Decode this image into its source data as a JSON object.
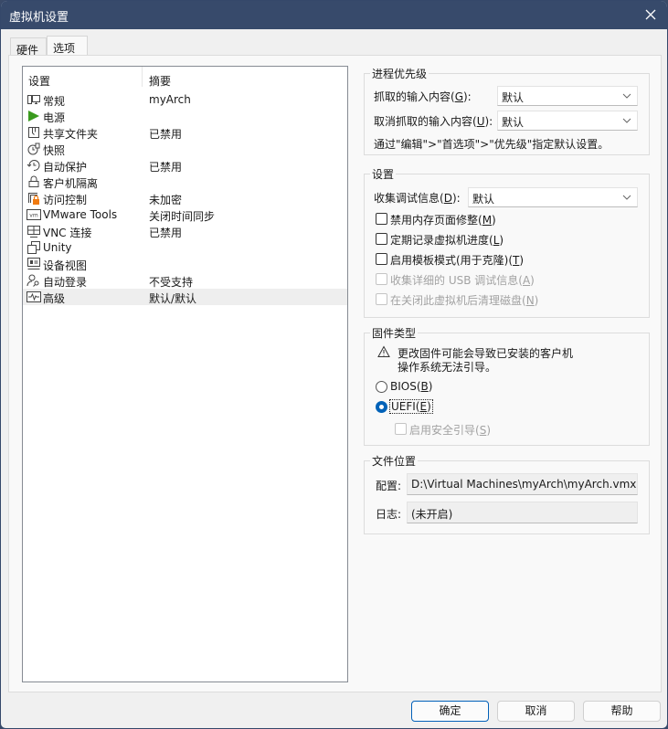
{
  "window": {
    "title": "虚拟机设置",
    "close_icon": "close-icon"
  },
  "tabs": [
    {
      "label": "硬件",
      "active": false
    },
    {
      "label": "选项",
      "active": true
    }
  ],
  "settings_list": {
    "columns": [
      "设置",
      "摘要"
    ],
    "items": [
      {
        "name": "常规",
        "summary": "myArch",
        "icon": "monitor-icon"
      },
      {
        "name": "电源",
        "summary": "",
        "icon": "power-play-icon"
      },
      {
        "name": "共享文件夹",
        "summary": "已禁用",
        "icon": "shared-folder-icon"
      },
      {
        "name": "快照",
        "summary": "",
        "icon": "snapshot-icon"
      },
      {
        "name": "自动保护",
        "summary": "已禁用",
        "icon": "autoprotect-clock-icon"
      },
      {
        "name": "客户机隔离",
        "summary": "",
        "icon": "lock-icon"
      },
      {
        "name": "访问控制",
        "summary": "未加密",
        "icon": "access-control-icon"
      },
      {
        "name": "VMware Tools",
        "summary": "关闭时间同步",
        "icon": "vmware-tools-icon"
      },
      {
        "name": "VNC 连接",
        "summary": "已禁用",
        "icon": "vnc-icon"
      },
      {
        "name": "Unity",
        "summary": "",
        "icon": "unity-icon"
      },
      {
        "name": "设备视图",
        "summary": "",
        "icon": "device-view-icon"
      },
      {
        "name": "自动登录",
        "summary": "不受支持",
        "icon": "autologin-key-icon"
      },
      {
        "name": "高级",
        "summary": "默认/默认",
        "icon": "advanced-pulse-icon",
        "selected": true
      }
    ]
  },
  "process_priority": {
    "legend": "进程优先级",
    "grabbed_label": "抓取的输入内容(",
    "grabbed_key": "G",
    "grabbed_suffix": "):",
    "grabbed_value": "默认",
    "ungrabbed_label": "取消抓取的输入内容(",
    "ungrabbed_key": "U",
    "ungrabbed_suffix": "):",
    "ungrabbed_value": "默认",
    "hint": "通过\"编辑\">\"首选项\">\"优先级\"指定默认设置。"
  },
  "settings": {
    "legend": "设置",
    "debug_label": "收集调试信息(",
    "debug_key": "D",
    "debug_suffix": "):",
    "debug_value": "默认",
    "checkboxes": [
      {
        "label": "禁用内存页面修整(",
        "key": "M",
        "suffix": ")",
        "checked": false,
        "enabled": true
      },
      {
        "label": "定期记录虚拟机进度(",
        "key": "L",
        "suffix": ")",
        "checked": false,
        "enabled": true
      },
      {
        "label": "启用模板模式(用于克隆)(",
        "key": "T",
        "suffix": ")",
        "checked": false,
        "enabled": true
      },
      {
        "label": "收集详细的 USB 调试信息(",
        "key": "A",
        "suffix": ")",
        "checked": false,
        "enabled": false
      },
      {
        "label": "在关闭此虚拟机后清理磁盘(",
        "key": "N",
        "suffix": ")",
        "checked": false,
        "enabled": false
      }
    ]
  },
  "firmware": {
    "legend": "固件类型",
    "warning_line1": "更改固件可能会导致已安装的客户机",
    "warning_line2": "操作系统无法引导。",
    "bios_label": "BIOS(",
    "bios_key": "B",
    "bios_suffix": ")",
    "uefi_label": "UEFI(",
    "uefi_key": "E",
    "uefi_suffix": ")",
    "selected": "UEFI",
    "secure_boot_label": "启用安全引导(",
    "secure_boot_key": "S",
    "secure_boot_suffix": ")",
    "secure_boot_checked": false
  },
  "file_location": {
    "legend": "文件位置",
    "config_label": "配置:",
    "config_value": "D:\\Virtual Machines\\myArch\\myArch.vmx",
    "log_label": "日志:",
    "log_value": "(未开启)"
  },
  "buttons": {
    "ok": "确定",
    "cancel": "取消",
    "help": "帮助"
  }
}
